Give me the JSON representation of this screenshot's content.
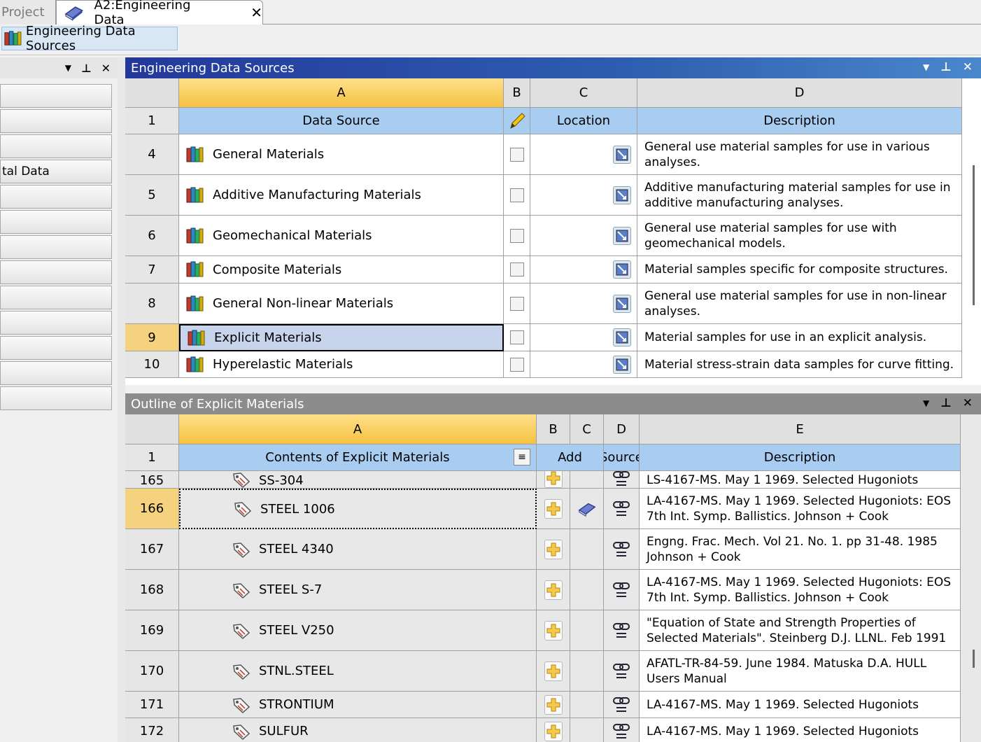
{
  "tabs": {
    "project_label": "Project",
    "active_label": "A2:Engineering Data",
    "close": "✕"
  },
  "toolbar": {
    "sources_button": "Engineering Data Sources"
  },
  "left_panel": {
    "visible_item_text": "tal Data"
  },
  "sources_panel": {
    "title": "Engineering Data Sources",
    "col_letters": [
      "A",
      "B",
      "C",
      "D"
    ],
    "row1_num": "1",
    "headers": {
      "data_source": "Data Source",
      "location": "Location",
      "description": "Description"
    },
    "rows": [
      {
        "num": "4",
        "name": "General Materials",
        "desc": "General use material samples for use in various analyses."
      },
      {
        "num": "5",
        "name": "Additive Manufacturing Materials",
        "desc": "Additive manufacturing material samples for use in additive manufacturing analyses."
      },
      {
        "num": "6",
        "name": "Geomechanical Materials",
        "desc": "General use material samples for use with geomechanical models."
      },
      {
        "num": "7",
        "name": "Composite Materials",
        "desc": "Material samples specific for composite structures."
      },
      {
        "num": "8",
        "name": "General Non-linear Materials",
        "desc": "General use material samples for use in non-linear analyses."
      },
      {
        "num": "9",
        "name": "Explicit Materials",
        "desc": "Material samples for use in an explicit analysis."
      },
      {
        "num": "10",
        "name": "Hyperelastic Materials",
        "desc": "Material stress-strain data samples for curve fitting."
      }
    ]
  },
  "outline_panel": {
    "title": "Outline of Explicit Materials",
    "col_letters": [
      "A",
      "B",
      "C",
      "D",
      "E"
    ],
    "row1_num": "1",
    "headers": {
      "contents": "Contents of Explicit Materials",
      "add": "Add",
      "source": "Source",
      "description": "Description"
    },
    "rows": [
      {
        "num": "165",
        "name": "SS-304",
        "desc": "LS-4167-MS. May 1 1969. Selected Hugoniots"
      },
      {
        "num": "166",
        "name": "STEEL 1006",
        "desc": "LA-4167-MS. May 1 1969. Selected Hugoniots: EOS 7th Int. Symp. Ballistics. Johnson + Cook"
      },
      {
        "num": "167",
        "name": "STEEL 4340",
        "desc": "Engng. Frac. Mech. Vol 21. No. 1. pp 31-48. 1985 Johnson + Cook"
      },
      {
        "num": "168",
        "name": "STEEL S-7",
        "desc": "LA-4167-MS. May 1 1969. Selected Hugoniots: EOS 7th Int. Symp. Ballistics. Johnson + Cook"
      },
      {
        "num": "169",
        "name": "STEEL V250",
        "desc": "\"Equation of State and Strength Properties of Selected Materials\". Steinberg D.J. LLNL. Feb 1991"
      },
      {
        "num": "170",
        "name": "STNL.STEEL",
        "desc": "AFATL-TR-84-59. June 1984. Matuska D.A. HULL Users Manual"
      },
      {
        "num": "171",
        "name": "STRONTIUM",
        "desc": "LA-4167-MS. May 1 1969. Selected Hugoniots"
      },
      {
        "num": "172",
        "name": "SULFUR",
        "desc": "LA-4167-MS. May 1 1969. Selected Hugoniots"
      }
    ]
  },
  "panel_controls": {
    "dropdown": "▼",
    "pin": "📌",
    "close": "✕"
  }
}
